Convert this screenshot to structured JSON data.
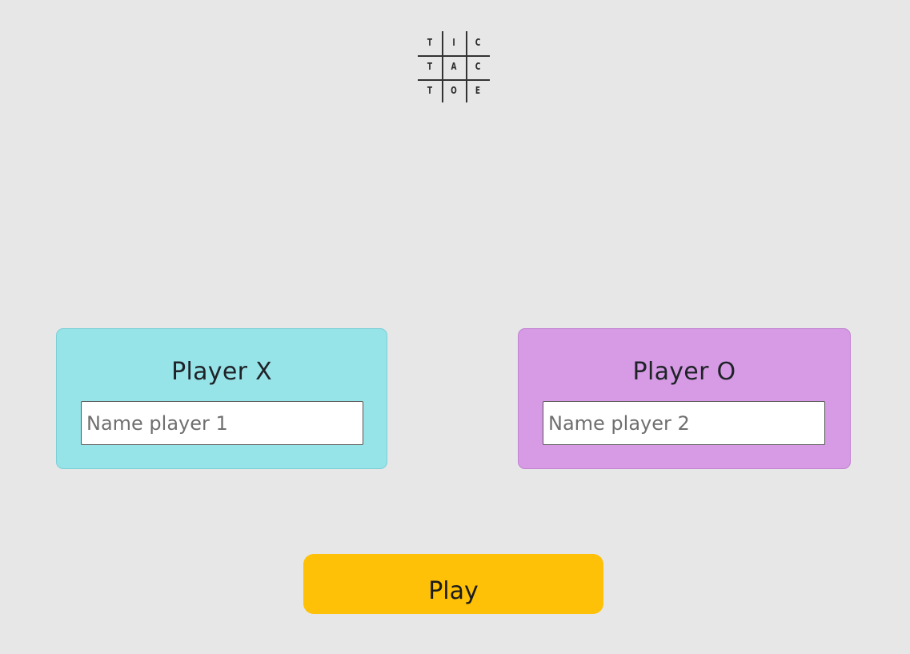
{
  "logo": {
    "letters": [
      "T",
      "I",
      "C",
      "T",
      "A",
      "C",
      "T",
      "O",
      "E"
    ]
  },
  "player_x": {
    "title": "Player X",
    "input_value": "",
    "input_placeholder": "Name player 1",
    "color": "#96e3e8"
  },
  "player_o": {
    "title": "Player O",
    "input_value": "",
    "input_placeholder": "Name player 2",
    "color": "#d69be4"
  },
  "play_button": {
    "label": "Play",
    "color": "#fec107"
  },
  "background_color": "#e7e7e7"
}
